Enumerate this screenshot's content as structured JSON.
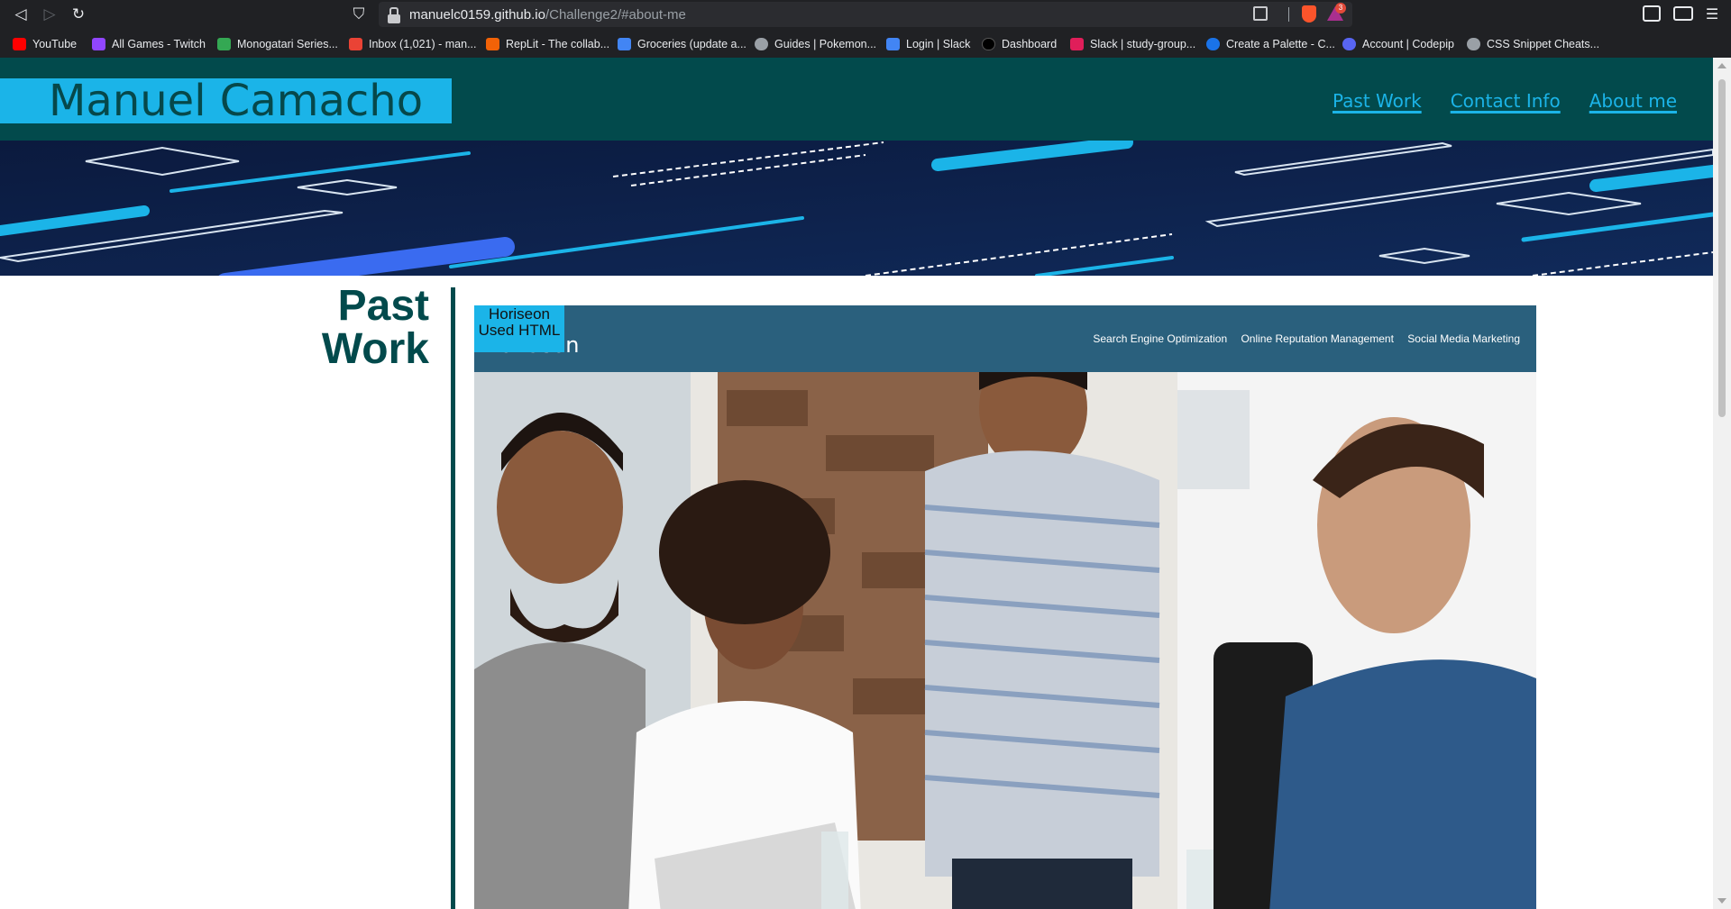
{
  "browser": {
    "nav": {
      "back": "◁",
      "forward": "▷",
      "reload": "↻",
      "bookmark": "⛉"
    },
    "url_host": "manuelc0159.github.io",
    "url_path": "/Challenge2/#about-me",
    "rewards_count": "3",
    "menu": "☰"
  },
  "bookmarks": [
    {
      "label": "YouTube",
      "color": "#ff0000"
    },
    {
      "label": "All Games - Twitch",
      "color": "#9146ff"
    },
    {
      "label": "Monogatari Series...",
      "color": "#34a853"
    },
    {
      "label": "Inbox (1,021) - man...",
      "color": "#ea4335"
    },
    {
      "label": "RepLit - The collab...",
      "color": "#f26207"
    },
    {
      "label": "Groceries (update a...",
      "color": "#4285f4"
    },
    {
      "label": "Guides | Pokemon...",
      "color": "#9aa0a6"
    },
    {
      "label": "Login | Slack",
      "color": "#4285f4"
    },
    {
      "label": "Dashboard",
      "color": "#000000"
    },
    {
      "label": "Slack | study-group...",
      "color": "#e01e5a"
    },
    {
      "label": "Create a Palette - C...",
      "color": "#1a73e8"
    },
    {
      "label": "Account | Codepip",
      "color": "#5865f2"
    },
    {
      "label": "CSS Snippet Cheats...",
      "color": "#9aa0a6"
    }
  ],
  "site": {
    "title": "Manuel Camacho",
    "nav": [
      "Past Work",
      "Contact Info",
      "About me"
    ],
    "section_title_line1": "Past",
    "section_title_line2": "Work",
    "project": {
      "brand": "Horiseon",
      "caption_line1": "Horiseon",
      "caption_line2": "Used HTML",
      "links": [
        "Search Engine Optimization",
        "Online Reputation Management",
        "Social Media Marketing"
      ]
    }
  },
  "colors": {
    "header_bg": "#024a4c",
    "accent": "#1bb4e8",
    "hero_bg": "#0d2048"
  }
}
